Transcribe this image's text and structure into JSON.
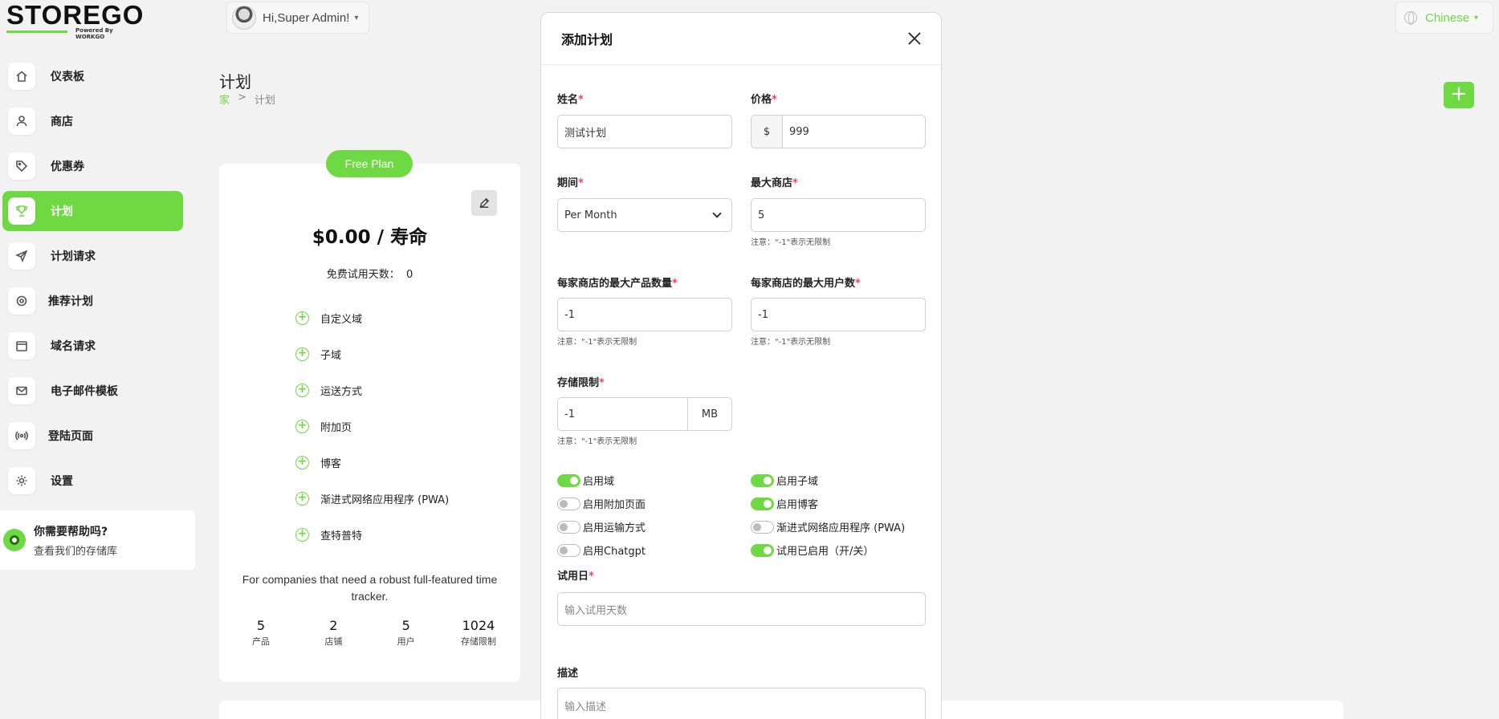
{
  "brand": {
    "logo_text": "STOREGO",
    "tagline": "Powered By WORKGO"
  },
  "header": {
    "greeting": "Hi,Super Admin!",
    "language": "Chinese"
  },
  "sidebar": {
    "items": [
      {
        "label": "仪表板",
        "icon": "home-icon"
      },
      {
        "label": "商店",
        "icon": "user-icon"
      },
      {
        "label": "优惠券",
        "icon": "tag-icon"
      },
      {
        "label": "计划",
        "icon": "trophy-icon",
        "active": true
      },
      {
        "label": "计划请求",
        "icon": "send-icon"
      },
      {
        "label": "推荐计划",
        "icon": "settings-icon"
      },
      {
        "label": "域名请求",
        "icon": "calendar-icon"
      },
      {
        "label": "电子邮件模板",
        "icon": "mail-icon"
      },
      {
        "label": "登陆页面",
        "icon": "broadcast-icon"
      },
      {
        "label": "设置",
        "icon": "gear-icon"
      }
    ],
    "help": {
      "title": "你需要帮助吗?",
      "subtitle": "查看我们的存储库"
    }
  },
  "page": {
    "title": "计划",
    "breadcrumb": {
      "home": "家",
      "separator": ">",
      "current": "计划"
    },
    "add_button": "+"
  },
  "plan": {
    "badge": "Free Plan",
    "price": "$0.00 / 寿命",
    "trial_label": "免费试用天数：",
    "trial_days": "0",
    "features": [
      "自定义域",
      "子域",
      "运送方式",
      "附加页",
      "博客",
      "渐进式网络应用程序 (PWA)",
      "查特普特"
    ],
    "description": "For companies that need a robust full-featured time tracker.",
    "stats": [
      {
        "value": "5",
        "label": "产品"
      },
      {
        "value": "2",
        "label": "店铺"
      },
      {
        "value": "5",
        "label": "用户"
      },
      {
        "value": "1024",
        "label": "存储限制"
      }
    ]
  },
  "modal": {
    "title": "添加计划",
    "name": {
      "label": "姓名",
      "value": "测试计划"
    },
    "price": {
      "label": "价格",
      "currency": "$",
      "value": "999"
    },
    "duration": {
      "label": "期间",
      "value": "Per Month"
    },
    "max_stores": {
      "label": "最大商店",
      "value": "5",
      "note": "注意：\"-1\"表示无限制"
    },
    "max_products": {
      "label": "每家商店的最大产品数量",
      "value": "-1",
      "note": "注意：\"-1\"表示无限制"
    },
    "max_users": {
      "label": "每家商店的最大用户数",
      "value": "-1",
      "note": "注意：\"-1\"表示无限制"
    },
    "storage": {
      "label": "存储限制",
      "value": "-1",
      "unit": "MB",
      "note": "注意：\"-1\"表示无限制"
    },
    "toggles": [
      {
        "label": "启用域",
        "on": true
      },
      {
        "label": "启用子域",
        "on": true
      },
      {
        "label": "启用附加页面",
        "on": false
      },
      {
        "label": "启用博客",
        "on": true
      },
      {
        "label": "启用运输方式",
        "on": false
      },
      {
        "label": "渐进式网络应用程序 (PWA)",
        "on": false
      },
      {
        "label": "启用Chatgpt",
        "on": false
      },
      {
        "label": "试用已启用（开/关）",
        "on": true
      }
    ],
    "trial_days": {
      "label": "试用日",
      "placeholder": "输入试用天数"
    },
    "description": {
      "label": "描述",
      "placeholder": "输入描述"
    },
    "required_mark": "*"
  },
  "colors": {
    "accent": "#6fd943",
    "required": "#ff3a6e"
  }
}
